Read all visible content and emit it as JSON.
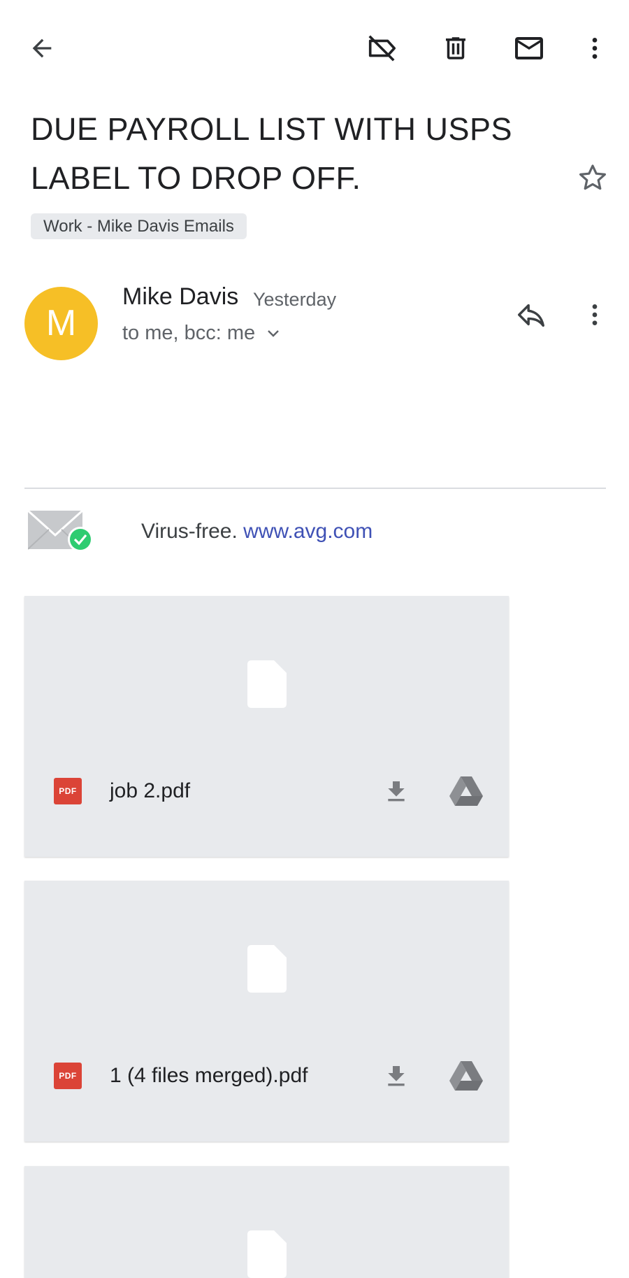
{
  "toolbar": {
    "back": "back-arrow-icon",
    "label_off": "label-off-icon",
    "delete": "trash-icon",
    "mark_unread": "mail-icon",
    "more": "more-vert-icon"
  },
  "email": {
    "subject": "DUE PAYROLL LIST WITH USPS LABEL TO DROP OFF.",
    "label_chip": "Work - Mike Davis Emails",
    "starred": false
  },
  "message": {
    "avatar_letter": "M",
    "avatar_color": "#f6bf26",
    "sender": "Mike Davis",
    "time": "Yesterday",
    "recipients": "to me, bcc: me"
  },
  "signature": {
    "text": "Virus-free.",
    "link": "www.avg.com"
  },
  "attachments": [
    {
      "type": "PDF",
      "name": "job 2.pdf"
    },
    {
      "type": "PDF",
      "name": "1 (4 files merged).pdf"
    },
    {
      "type": "",
      "name": ""
    }
  ],
  "colors": {
    "accent_link": "#3f51b5",
    "pdf_red": "#db4437",
    "attachment_bg": "#e8eaed"
  }
}
